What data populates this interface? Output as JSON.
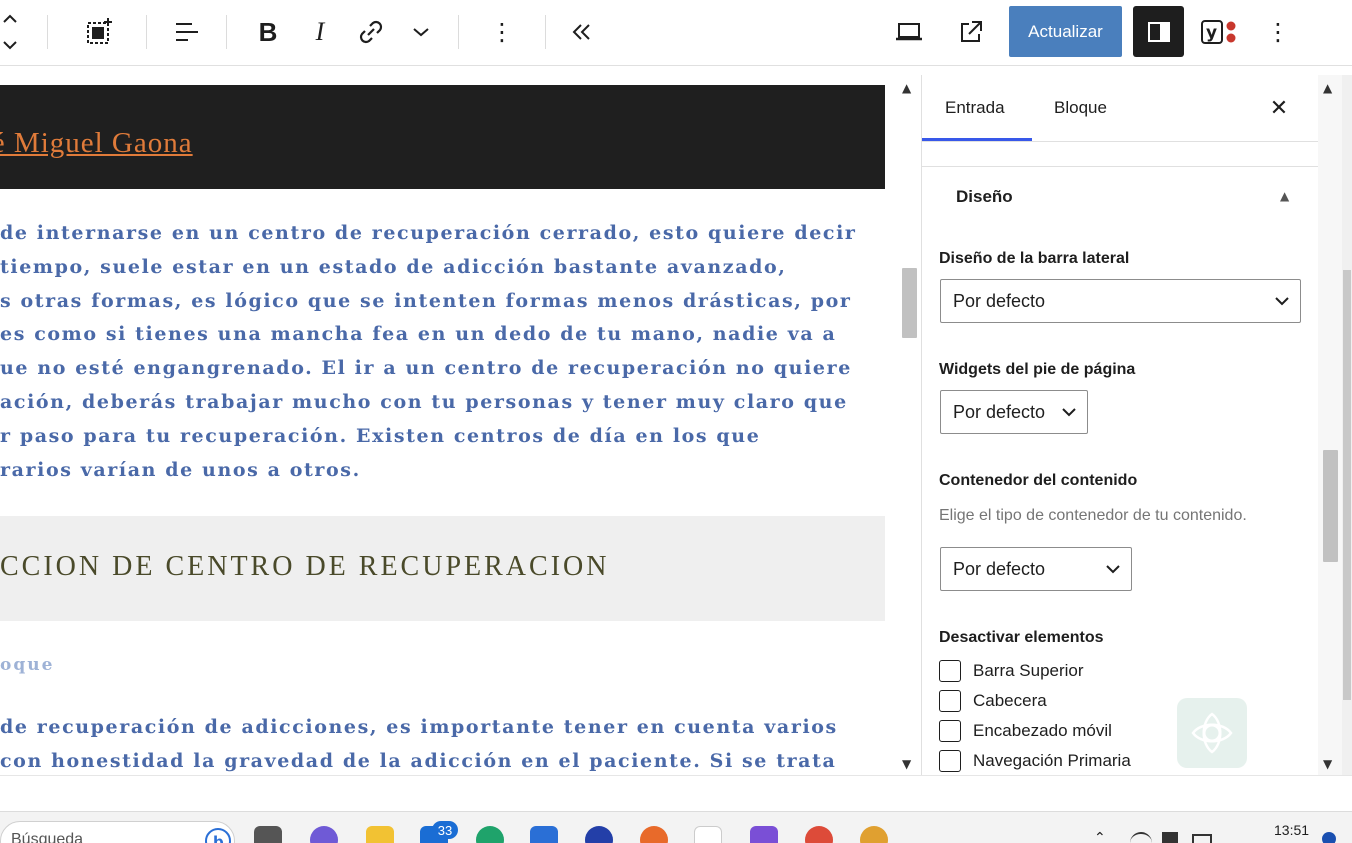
{
  "toolbar": {
    "update_label": "Actualizar",
    "icons": [
      "move-updown-icon",
      "select-parent-icon",
      "align-icon",
      "bold-icon",
      "italic-icon",
      "link-icon",
      "more-options-chevron-icon",
      "block-options-icon",
      "collapse-icon",
      "preview-device-icon",
      "view-post-icon",
      "settings-panel-icon",
      "yoast-icon",
      "options-icon"
    ],
    "bold_glyph": "B",
    "italic_glyph": "I",
    "collapse_glyph": "«",
    "more_glyph": "⋮"
  },
  "content": {
    "author_link": "osé Miguel Gaona",
    "paragraph1": [
      "de internarse en un centro de recuperación cerrado, esto quiere decir",
      " tiempo, suele estar en un estado de adicción bastante avanzado,",
      "s otras formas, es lógico que se intenten formas menos drásticas, por",
      "es como si tienes una mancha fea en un dedo de tu mano, nadie va a",
      "ue no esté engangrenado. El ir a un centro de recuperación no quiere",
      "ación, deberás trabajar mucho con tu personas y tener muy claro que",
      "r paso para tu recuperación. Existen centros de día en los que",
      "rarios varían de unos a otros."
    ],
    "heading": "CCION DE CENTRO DE RECUPERACION",
    "bloque_label": "oque",
    "paragraph2": [
      "de recuperación de adicciones, es importante tener en cuenta varios",
      " con honestidad la gravedad de la adicción en el paciente. Si se trata"
    ]
  },
  "sidebar": {
    "tabs": [
      {
        "label": "Entrada",
        "active": true
      },
      {
        "label": "Bloque",
        "active": false
      }
    ],
    "panel_title": "Diseño",
    "fields": {
      "sidebar_layout": {
        "label": "Diseño de la barra lateral",
        "value": "Por defecto"
      },
      "footer_widgets": {
        "label": "Widgets del pie de página",
        "value": "Por defecto"
      },
      "content_container": {
        "label": "Contenedor del contenido",
        "help": "Elige el tipo de contenedor de tu contenido.",
        "value": "Por defecto"
      }
    },
    "disable_elements": {
      "label": "Desactivar elementos",
      "items": [
        {
          "label": "Barra Superior",
          "checked": false
        },
        {
          "label": "Cabecera",
          "checked": false
        },
        {
          "label": "Encabezado móvil",
          "checked": false
        },
        {
          "label": "Navegación Primaria",
          "checked": false
        }
      ]
    }
  },
  "taskbar": {
    "search_placeholder": "Búsqueda",
    "mail_badge": "33",
    "time": "13:51"
  },
  "colors": {
    "accent": "#3858e9",
    "update_button": "#4a7fbd",
    "author_link": "#e07b3a",
    "paragraph_text": "#4a69a8",
    "heading_band": "#efefef"
  }
}
